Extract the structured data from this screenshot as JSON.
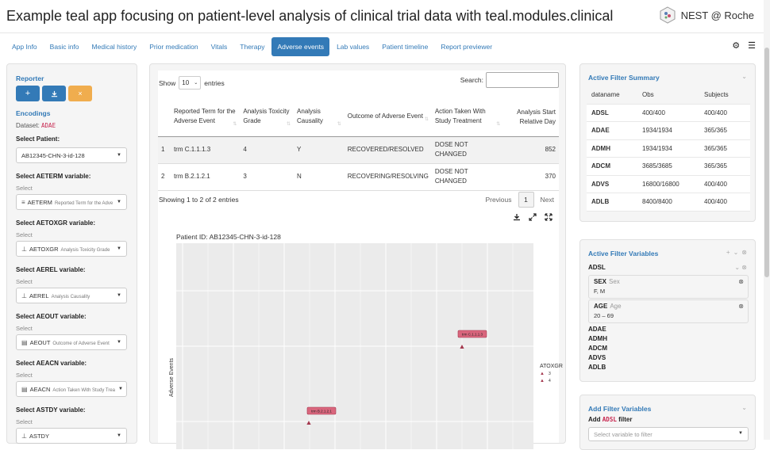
{
  "header": {
    "title": "Example teal app focusing on patient-level analysis of clinical trial data with teal.modules.clinical",
    "brand": "NEST @ Roche",
    "logo_icon": "hexagon-logo-icon"
  },
  "tabs": [
    {
      "label": "App Info"
    },
    {
      "label": "Basic info"
    },
    {
      "label": "Medical history"
    },
    {
      "label": "Prior medication"
    },
    {
      "label": "Vitals"
    },
    {
      "label": "Therapy"
    },
    {
      "label": "Adverse events",
      "active": true
    },
    {
      "label": "Lab values"
    },
    {
      "label": "Patient timeline"
    },
    {
      "label": "Report previewer"
    }
  ],
  "toolbar": {
    "gear": "⚙",
    "menu": "☰"
  },
  "encodings": {
    "reporter_label": "Reporter",
    "encodings_label": "Encodings",
    "dataset_label": "Dataset:",
    "dataset_value": "ADAE",
    "patient_label": "Select Patient:",
    "patient_value": "AB12345-CHN-3-id-128",
    "select_placeholder": "Select",
    "fields": [
      {
        "label": "Select AETERM variable:",
        "var": "AETERM",
        "desc": "Reported Term for the Adve",
        "icon": "≡"
      },
      {
        "label": "Select AETOXGR variable:",
        "var": "AETOXGR",
        "desc": "Analysis Toxicity Grade",
        "icon": "⊥"
      },
      {
        "label": "Select AEREL variable:",
        "var": "AEREL",
        "desc": "Analysis Causality",
        "icon": "⊥"
      },
      {
        "label": "Select AEOUT variable:",
        "var": "AEOUT",
        "desc": "Outcome of Adverse Event",
        "icon": "▤"
      },
      {
        "label": "Select AEACN variable:",
        "var": "AEACN",
        "desc": "Action Taken With Study Trea",
        "icon": "▤"
      },
      {
        "label": "Select ASTDY variable:",
        "var": "ASTDY",
        "desc": "",
        "icon": "⊥"
      }
    ]
  },
  "table": {
    "show_label": "Show",
    "entries_label": "entries",
    "page_length": "10",
    "search_label": "Search:",
    "columns": [
      "",
      "Reported Term for the Adverse Event",
      "Analysis Toxicity Grade",
      "Analysis Causality",
      "Outcome of Adverse Event",
      "Action Taken With Study Treatment",
      "Analysis Start Relative Day"
    ],
    "rows": [
      [
        "1",
        "trm C.1.1.1.3",
        "4",
        "Y",
        "RECOVERED/RESOLVED",
        "DOSE NOT CHANGED",
        "852"
      ],
      [
        "2",
        "trm B.2.1.2.1",
        "3",
        "N",
        "RECOVERING/RESOLVING",
        "DOSE NOT CHANGED",
        "370"
      ]
    ],
    "info": "Showing 1 to 2 of 2 entries",
    "previous": "Previous",
    "next": "Next",
    "current_page": "1"
  },
  "plot": {
    "title": "Patient ID: AB12345-CHN-3-id-128",
    "ylabel": "Adverse Events",
    "legend_title": "ATOXGR",
    "legend_items": [
      "3",
      "4"
    ],
    "colors": {
      "panel": "#ebebeb",
      "marker": "#a4384e",
      "label_fill": "#d9667d"
    }
  },
  "chart_data": {
    "type": "scatter",
    "ylabel": "Adverse Events",
    "legend": "ATOXGR",
    "points": [
      {
        "term": "trm C.1.1.1.3",
        "grade": "4"
      },
      {
        "term": "trm B.2.1.2.1",
        "grade": "3"
      }
    ]
  },
  "filter_summary": {
    "title": "Active Filter Summary",
    "columns": [
      "dataname",
      "Obs",
      "Subjects"
    ],
    "rows": [
      [
        "ADSL",
        "400/400",
        "400/400"
      ],
      [
        "ADAE",
        "1934/1934",
        "365/365"
      ],
      [
        "ADMH",
        "1934/1934",
        "365/365"
      ],
      [
        "ADCM",
        "3685/3685",
        "365/365"
      ],
      [
        "ADVS",
        "16800/16800",
        "400/400"
      ],
      [
        "ADLB",
        "8400/8400",
        "400/400"
      ]
    ]
  },
  "active_vars": {
    "title": "Active Filter Variables",
    "dataset": "ADSL",
    "filters": [
      {
        "name": "SEX",
        "label": "Sex",
        "value": "F, M"
      },
      {
        "name": "AGE",
        "label": "Age",
        "value": "20 – 69"
      }
    ],
    "datasets": [
      "ADAE",
      "ADMH",
      "ADCM",
      "ADVS",
      "ADLB"
    ]
  },
  "add_vars": {
    "title": "Add Filter Variables",
    "add_prefix": "Add",
    "add_dataset": "ADSL",
    "add_suffix": "filter",
    "placeholder": "Select variable to filter"
  }
}
